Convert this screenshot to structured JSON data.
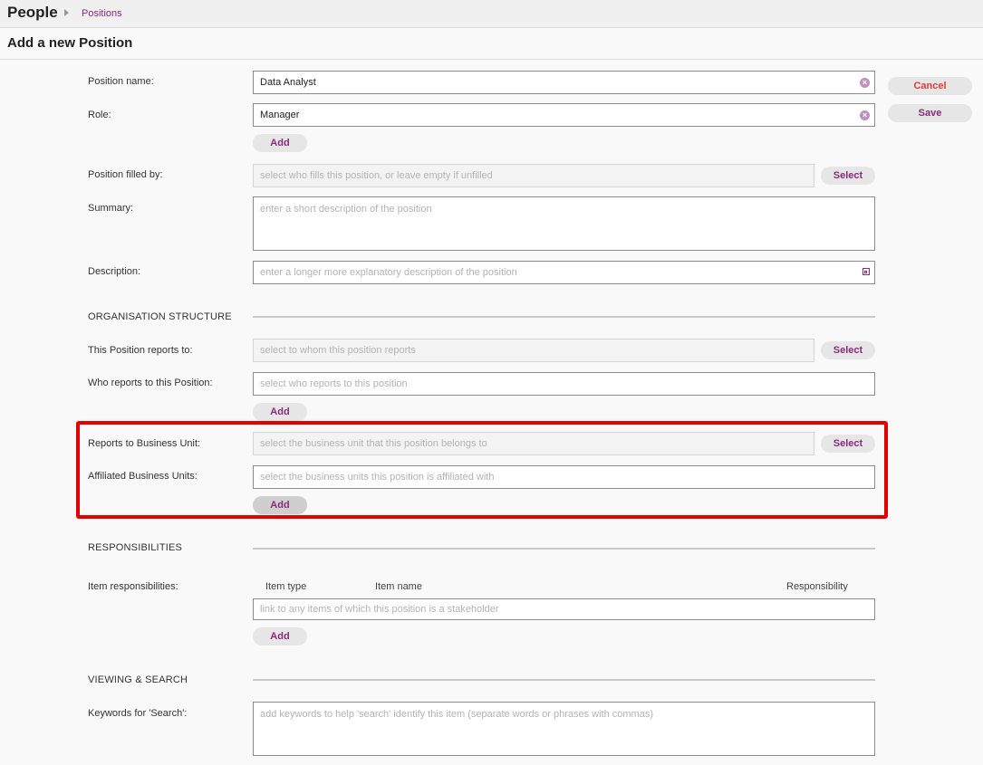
{
  "breadcrumb": {
    "app": "People",
    "section": "Positions"
  },
  "page": {
    "title": "Add a new Position"
  },
  "actions": {
    "cancel": "Cancel",
    "save": "Save"
  },
  "form": {
    "position_name": {
      "label": "Position name:",
      "value": "Data Analyst"
    },
    "role": {
      "label": "Role:",
      "value": "Manager",
      "add": "Add"
    },
    "filled_by": {
      "label": "Position filled by:",
      "placeholder": "select who fills this position, or leave empty if unfilled",
      "select": "Select"
    },
    "summary": {
      "label": "Summary:",
      "placeholder": "enter a short description of the position"
    },
    "description": {
      "label": "Description:",
      "placeholder": "enter a longer more explanatory description of the position"
    }
  },
  "org_structure": {
    "heading": "ORGANISATION STRUCTURE",
    "reports_to": {
      "label": "This Position reports to:",
      "placeholder": "select to whom this position reports",
      "select": "Select"
    },
    "who_reports": {
      "label": "Who reports to this Position:",
      "placeholder": "select who reports to this position",
      "add": "Add"
    },
    "business_unit": {
      "label": "Reports to Business Unit:",
      "placeholder": "select the business unit that this position belongs to",
      "select": "Select"
    },
    "affiliated_units": {
      "label": "Affiliated Business Units:",
      "placeholder": "select the business units this position is affiliated with",
      "add": "Add"
    }
  },
  "responsibilities": {
    "heading": "RESPONSIBILITIES",
    "label": "Item responsibilities:",
    "columns": [
      "Item type",
      "Item name",
      "Responsibility"
    ],
    "placeholder": "link to any items of which this position is a stakeholder",
    "add": "Add"
  },
  "viewing": {
    "heading": "VIEWING & SEARCH",
    "keywords": {
      "label": "Keywords for 'Search':",
      "placeholder": "add keywords to help 'search' identify this item (separate words or phrases with commas)"
    }
  },
  "colors": {
    "accent": "#8a2a7c",
    "cancel": "#e33a3a",
    "highlight": "#e50000"
  },
  "icons": {
    "clear": "clear-circle-icon",
    "expand": "expand-icon",
    "breadcrumb": "triangle-right-icon"
  }
}
